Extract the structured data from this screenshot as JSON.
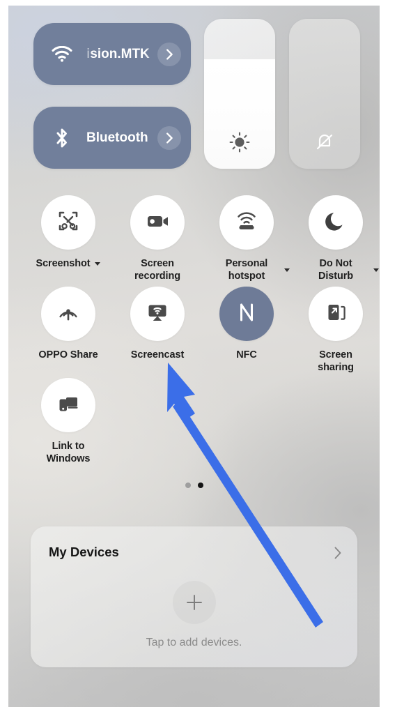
{
  "screen": {
    "name": "control-center",
    "accent_active": "#6e7b97",
    "accent_pill": "#717f9b",
    "arrow_color": "#3b6ee8"
  },
  "connectivity": [
    {
      "id": "wifi",
      "icon": "wifi-icon",
      "label": "ision.MTK",
      "chevron": "›",
      "active": true
    },
    {
      "id": "bluetooth",
      "icon": "bluetooth-icon",
      "label": "Bluetooth",
      "chevron": "›",
      "active": true
    }
  ],
  "sliders": [
    {
      "id": "brightness",
      "icon": "brightness-sun-icon",
      "value": 73,
      "muted": false
    },
    {
      "id": "volume",
      "icon": "bell-mute-icon",
      "value": 0,
      "muted": true
    }
  ],
  "toggles": [
    {
      "id": "screenshot",
      "icon": "screenshot-scissors-icon",
      "label": "Screenshot",
      "lines": [
        "Screenshot"
      ],
      "caret": true,
      "caret_inline": true,
      "on": false
    },
    {
      "id": "screen-recording",
      "icon": "video-camera-icon",
      "label": "Screen recording",
      "lines": [
        "Screen",
        "recording"
      ],
      "caret": false,
      "caret_inline": false,
      "on": false
    },
    {
      "id": "personal-hotspot",
      "icon": "hotspot-icon",
      "label": "Personal hotspot",
      "lines": [
        "Personal",
        "hotspot"
      ],
      "caret": true,
      "caret_inline": false,
      "on": false
    },
    {
      "id": "do-not-disturb",
      "icon": "moon-icon",
      "label": "Do Not Disturb",
      "lines": [
        "Do Not",
        "Disturb"
      ],
      "caret": true,
      "caret_inline": false,
      "on": false
    },
    {
      "id": "oppo-share",
      "icon": "oppo-share-icon",
      "label": "OPPO Share",
      "lines": [
        "OPPO Share"
      ],
      "caret": false,
      "caret_inline": false,
      "on": false
    },
    {
      "id": "screencast",
      "icon": "screencast-icon",
      "label": "Screencast",
      "lines": [
        "Screencast"
      ],
      "caret": false,
      "caret_inline": false,
      "on": false
    },
    {
      "id": "nfc",
      "icon": "nfc-icon",
      "label": "NFC",
      "lines": [
        "NFC"
      ],
      "caret": false,
      "caret_inline": false,
      "on": true
    },
    {
      "id": "screen-sharing",
      "icon": "screen-sharing-icon",
      "label": "Screen sharing",
      "lines": [
        "Screen",
        "sharing"
      ],
      "caret": false,
      "caret_inline": false,
      "on": false
    },
    {
      "id": "link-to-windows",
      "icon": "link-to-windows-icon",
      "label": "Link to Windows",
      "lines": [
        "Link to",
        "Windows"
      ],
      "caret": false,
      "caret_inline": false,
      "on": false
    }
  ],
  "pager": {
    "count": 2,
    "active_index": 1
  },
  "my_devices": {
    "title": "My Devices",
    "chevron": "›",
    "add_icon": "plus-icon",
    "hint": "Tap to add devices."
  }
}
